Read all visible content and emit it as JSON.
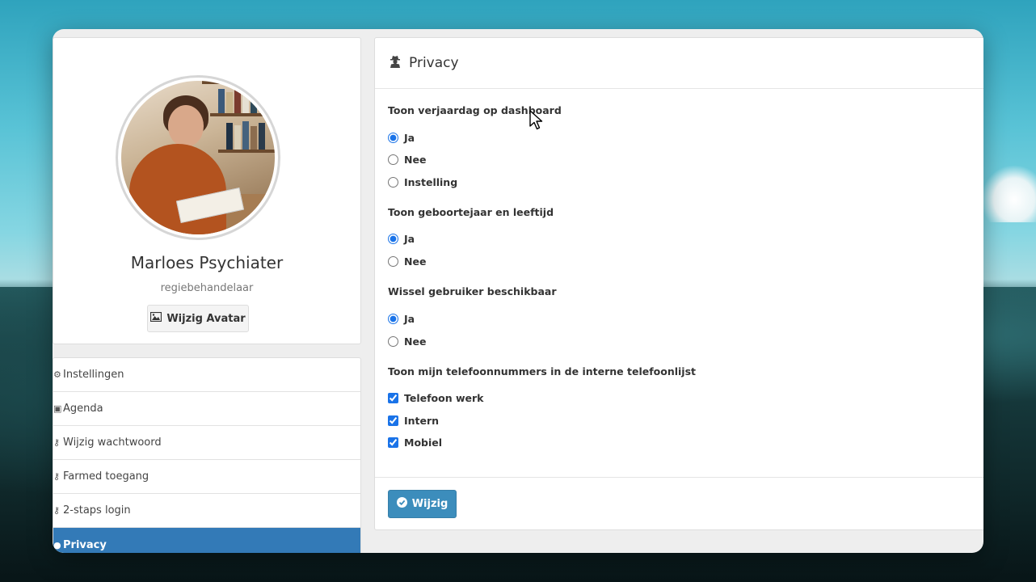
{
  "colors": {
    "primary": "#3c8dbc",
    "nav_active": "#337ab7"
  },
  "profile": {
    "name": "Marloes Psychiater",
    "role": "regiebehandelaar",
    "avatar_button": {
      "icon": "image-icon",
      "label": "Wijzig Avatar"
    }
  },
  "nav": {
    "items": [
      {
        "label": "Instellingen",
        "icon": "cogs-icon"
      },
      {
        "label": "Agenda",
        "icon": "calendar-icon"
      },
      {
        "label": "Wijzig wachtwoord",
        "icon": "key-icon"
      },
      {
        "label": "Farmed toegang",
        "icon": "key-icon"
      },
      {
        "label": "2-staps login",
        "icon": "key-icon"
      },
      {
        "label": "Privacy",
        "icon": "user-secret-icon",
        "active": true
      }
    ]
  },
  "privacy": {
    "title": "Privacy",
    "title_icon": "user-secret-icon",
    "birthday": {
      "label": "Toon verjaardag op dashboard",
      "options": [
        "Ja",
        "Nee",
        "Instelling"
      ],
      "selected": "Ja"
    },
    "birthyear": {
      "label": "Toon geboortejaar en leeftijd",
      "options": [
        "Ja",
        "Nee"
      ],
      "selected": "Ja"
    },
    "switch_user": {
      "label": "Wissel gebruiker beschikbaar",
      "options": [
        "Ja",
        "Nee"
      ],
      "selected": "Ja"
    },
    "phones": {
      "label": "Toon mijn telefoonnummers in de interne telefoonlijst",
      "options": [
        {
          "label": "Telefoon werk",
          "checked": true
        },
        {
          "label": "Intern",
          "checked": true
        },
        {
          "label": "Mobiel",
          "checked": true
        }
      ]
    },
    "submit": {
      "icon": "check-circle-icon",
      "label": "Wijzig"
    }
  }
}
